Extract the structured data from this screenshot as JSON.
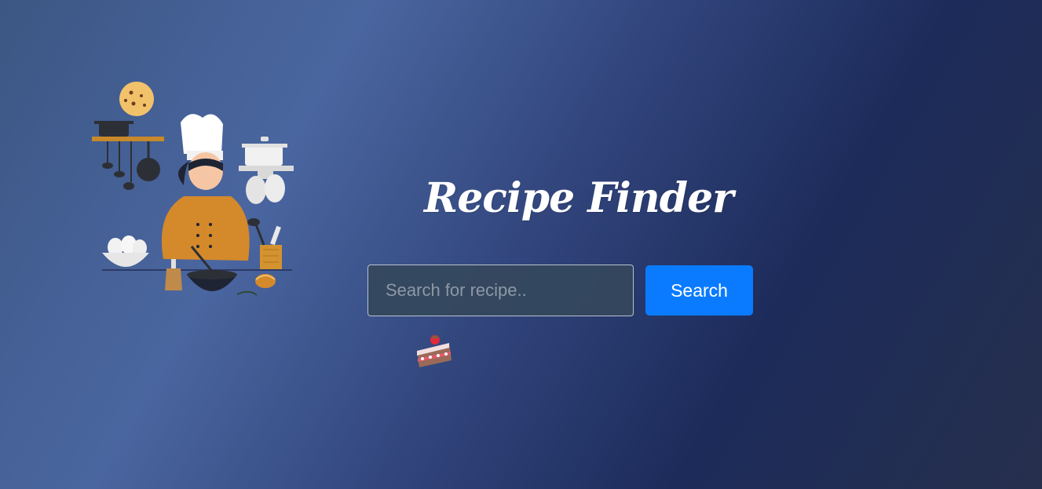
{
  "app": {
    "title": "Recipe Finder"
  },
  "search": {
    "placeholder": "Search for recipe..",
    "value": "",
    "button_label": "Search"
  },
  "colors": {
    "accent": "#0a7bff",
    "input_background": "#34485c",
    "title_text": "#ffffff"
  },
  "icons": {
    "hero": "chef-cooking-illustration",
    "decor": "strawberry-cake-icon"
  }
}
